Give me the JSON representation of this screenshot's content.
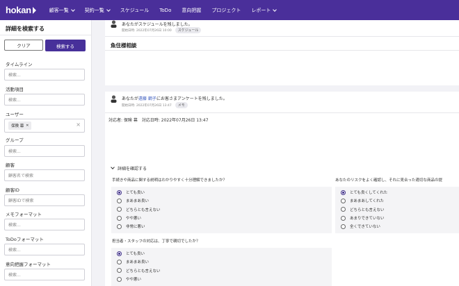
{
  "nav": {
    "logo": "hokan",
    "items": [
      {
        "label": "顧客一覧",
        "dropdown": true
      },
      {
        "label": "契約一覧",
        "dropdown": true
      },
      {
        "label": "スケジュール",
        "dropdown": false
      },
      {
        "label": "ToDo",
        "dropdown": false
      },
      {
        "label": "意向把握",
        "dropdown": false
      },
      {
        "label": "プロジェクト",
        "dropdown": false
      },
      {
        "label": "レポート",
        "dropdown": true
      }
    ]
  },
  "sidebar": {
    "title": "詳細を検索する",
    "clear_label": "クリア",
    "search_label": "検索する",
    "filters": [
      {
        "label": "タイムライン",
        "placeholder": "検索..."
      },
      {
        "label": "活動項目",
        "placeholder": "検索..."
      },
      {
        "label": "ユーザー",
        "chip": "保険 幕"
      },
      {
        "label": "グループ",
        "placeholder": "検索..."
      },
      {
        "label": "顧客",
        "placeholder": "顧客名で検索"
      },
      {
        "label": "顧客ID",
        "placeholder": "顧客IDで検索"
      },
      {
        "label": "メモフォーマット",
        "placeholder": "検索..."
      },
      {
        "label": "ToDoフォーマット",
        "placeholder": "検索..."
      },
      {
        "label": "意向把握フォーマット",
        "placeholder": "検索..."
      }
    ]
  },
  "feed": {
    "item1": {
      "text": "あなたがスケジュールを残しました。",
      "date": "開始日時: 2022年07月26日 10:00",
      "badge": "スケジュール",
      "title": "魚住様相談"
    },
    "item2": {
      "text_prefix": "あなたが",
      "link": "遠藤 鋼子",
      "text_suffix": "にお客さまアンケートを残しました。",
      "date": "開始日時: 2022年07月26日 13:47",
      "badge": "メモ",
      "responder": "対応者: 保険 幕",
      "response_date": "対応日時: 2022年07月26日 13:47",
      "expand": "詳細を確認する",
      "q1": {
        "title": "手続きや商品に関する説明はわかりやすく十分理解できましたか？",
        "options": [
          "とても良い",
          "まあまあ良い",
          "どちらとも言えない",
          "やや悪い",
          "非常に悪い"
        ],
        "selected": 0
      },
      "q2": {
        "title": "担当者・スタッフの対応は、丁寧で親切でしたか？",
        "options": [
          "とても良い",
          "まあまあ良い",
          "どちらとも言えない",
          "やや悪い"
        ],
        "selected": 0
      },
      "q3": {
        "title": "あなたのリスクをよく確認し、それに見合った適切な商品の提",
        "options": [
          "とても良くしてくれた",
          "まあまあしてくれた",
          "どちらとも言えない",
          "あまりできていない",
          "全くできていない"
        ],
        "selected": 0
      }
    }
  }
}
